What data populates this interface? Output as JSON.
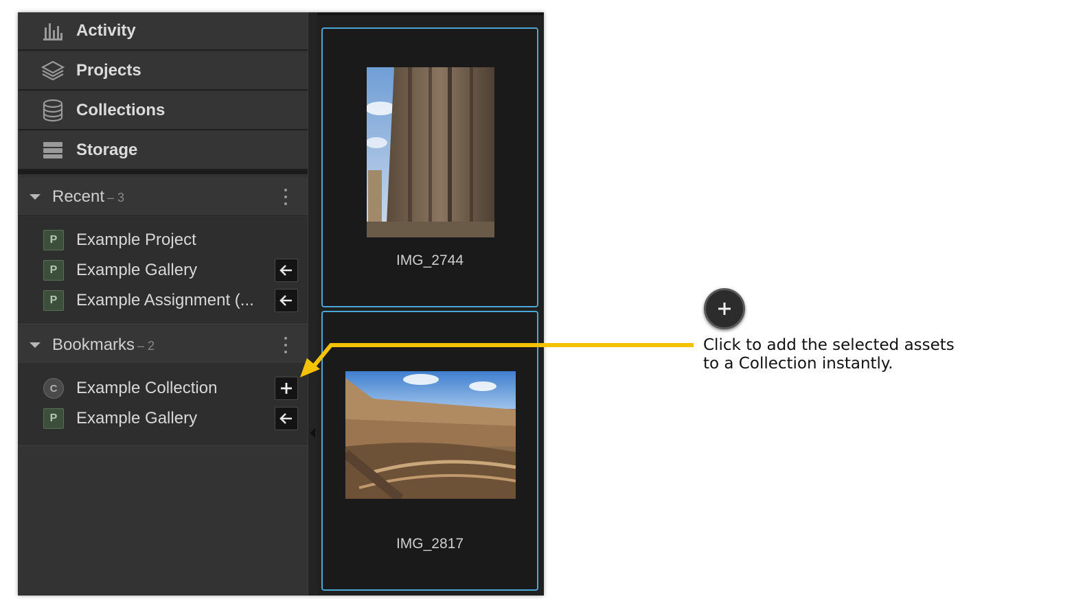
{
  "nav": {
    "items": [
      {
        "label": "Activity",
        "icon": "bar-chart-icon"
      },
      {
        "label": "Projects",
        "icon": "layers-icon"
      },
      {
        "label": "Collections",
        "icon": "database-icon"
      },
      {
        "label": "Storage",
        "icon": "storage-icon"
      }
    ]
  },
  "recent": {
    "title": "Recent",
    "count": "– 3",
    "items": [
      {
        "label": "Example Project",
        "badge": "P"
      },
      {
        "label": "Example Gallery",
        "badge": "P"
      },
      {
        "label": "Example Assignment (...",
        "badge": "P"
      }
    ]
  },
  "bookmarks": {
    "title": "Bookmarks",
    "count": "– 2",
    "items": [
      {
        "label": "Example Collection",
        "badge": "C"
      },
      {
        "label": "Example Gallery",
        "badge": "P"
      }
    ]
  },
  "assets": [
    {
      "name": "IMG_2744"
    },
    {
      "name": "IMG_2817"
    }
  ],
  "annotation": {
    "line1": "Click to add the selected assets",
    "line2": "to a Collection instantly."
  },
  "colors": {
    "selection_border": "#4aa8d6",
    "callout_arrow": "#f5c200"
  }
}
